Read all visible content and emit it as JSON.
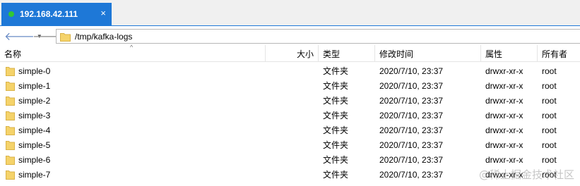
{
  "tab": {
    "title": "192.168.42.111",
    "close": "×",
    "status_color": "#32c832"
  },
  "nav": {
    "back_glyph": "🡐",
    "forward_glyph": "🡒",
    "caret": "▼"
  },
  "address": {
    "path": "/tmp/kafka-logs"
  },
  "columns": {
    "name": "名称",
    "size": "大小",
    "type": "类型",
    "modified": "修改时间",
    "attributes": "属性",
    "owner": "所有者"
  },
  "rows": [
    {
      "name": "simple-0",
      "type": "文件夹",
      "modified": "2020/7/10, 23:37",
      "attributes": "drwxr-xr-x",
      "owner": "root"
    },
    {
      "name": "simple-1",
      "type": "文件夹",
      "modified": "2020/7/10, 23:37",
      "attributes": "drwxr-xr-x",
      "owner": "root"
    },
    {
      "name": "simple-2",
      "type": "文件夹",
      "modified": "2020/7/10, 23:37",
      "attributes": "drwxr-xr-x",
      "owner": "root"
    },
    {
      "name": "simple-3",
      "type": "文件夹",
      "modified": "2020/7/10, 23:37",
      "attributes": "drwxr-xr-x",
      "owner": "root"
    },
    {
      "name": "simple-4",
      "type": "文件夹",
      "modified": "2020/7/10, 23:37",
      "attributes": "drwxr-xr-x",
      "owner": "root"
    },
    {
      "name": "simple-5",
      "type": "文件夹",
      "modified": "2020/7/10, 23:37",
      "attributes": "drwxr-xr-x",
      "owner": "root"
    },
    {
      "name": "simple-6",
      "type": "文件夹",
      "modified": "2020/7/10, 23:37",
      "attributes": "drwxr-xr-x",
      "owner": "root"
    },
    {
      "name": "simple-7",
      "type": "文件夹",
      "modified": "2020/7/10, 23:37",
      "attributes": "drwxr-xr-x",
      "owner": "root"
    }
  ],
  "watermark": "@稀土掘金技术社区",
  "colors": {
    "tab_active": "#1e78d7",
    "folder": "#f5d36a"
  }
}
